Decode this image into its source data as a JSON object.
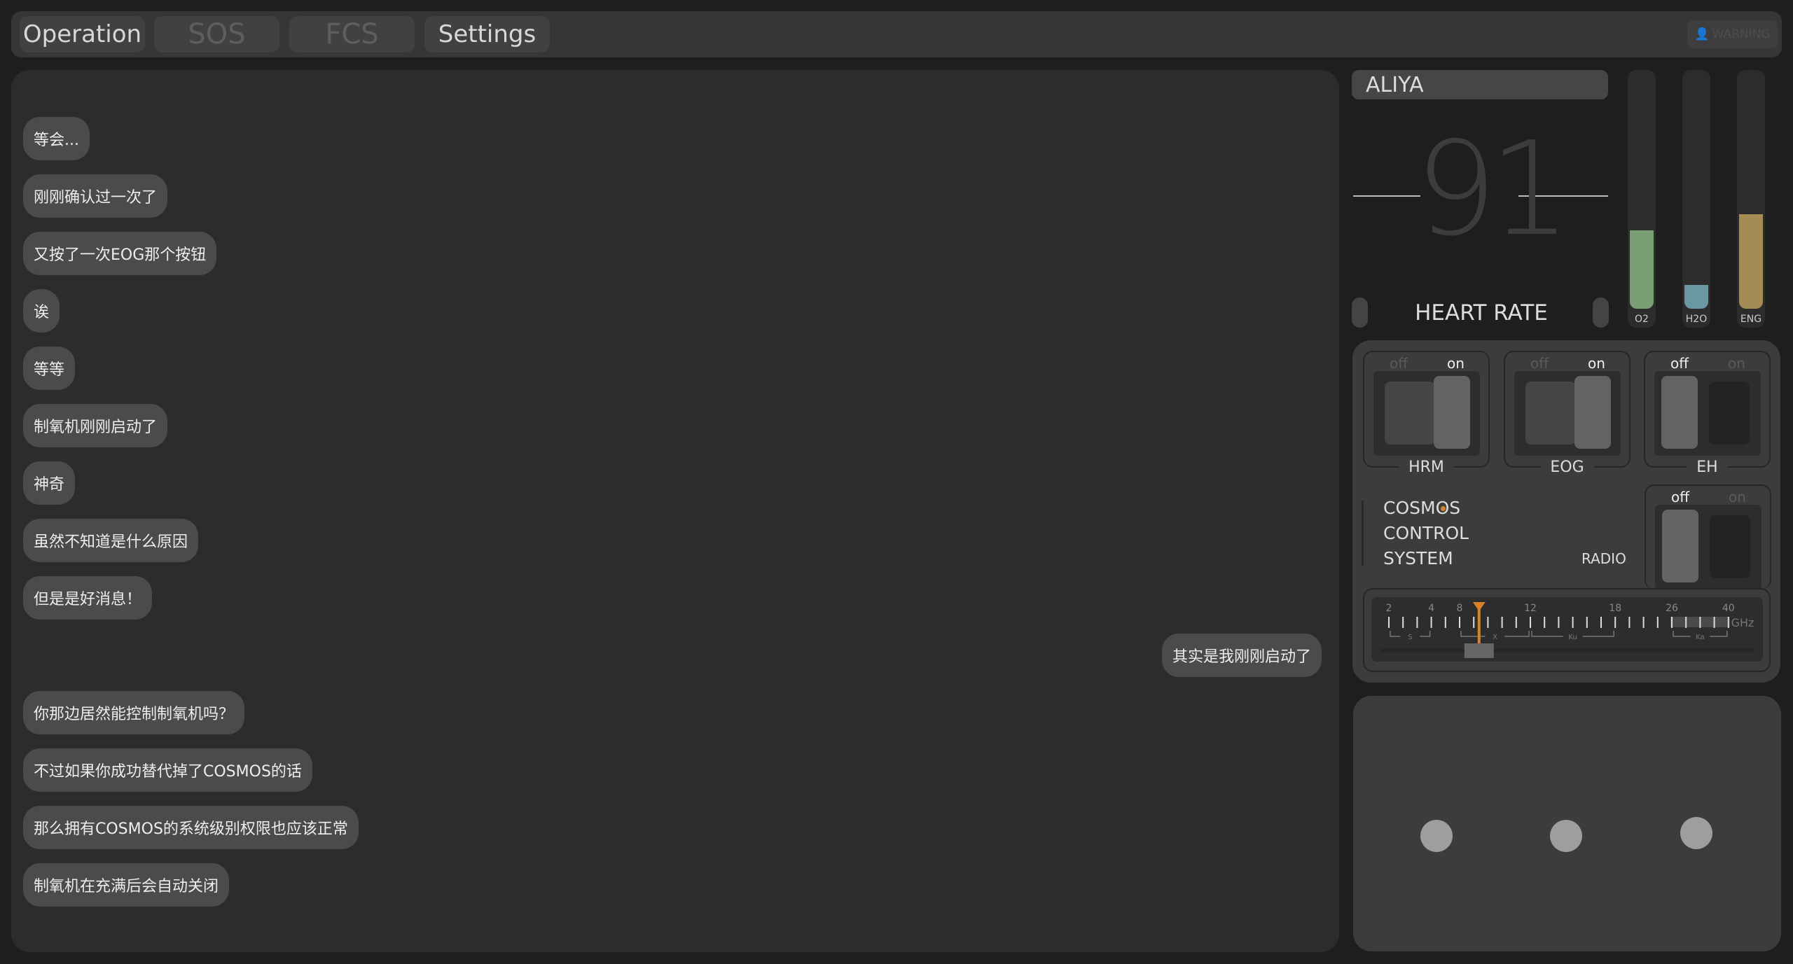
{
  "tabs": [
    {
      "label": "Operation",
      "enabled": true
    },
    {
      "label": "SOS",
      "enabled": false
    },
    {
      "label": "FCS",
      "enabled": false
    },
    {
      "label": "Settings",
      "enabled": true
    }
  ],
  "warning": {
    "label": "WARNING",
    "icon": "person-icon"
  },
  "chat": {
    "messages": [
      {
        "text": "等会...",
        "side": "left"
      },
      {
        "text": "刚刚确认过一次了",
        "side": "left"
      },
      {
        "text": "又按了一次EOG那个按钮",
        "side": "left"
      },
      {
        "text": "诶",
        "side": "left"
      },
      {
        "text": "等等",
        "side": "left"
      },
      {
        "text": "制氧机刚刚启动了",
        "side": "left"
      },
      {
        "text": "神奇",
        "side": "left"
      },
      {
        "text": "虽然不知道是什么原因",
        "side": "left"
      },
      {
        "text": "但是是好消息！",
        "side": "left"
      },
      {
        "text": "其实是我刚刚启动了",
        "side": "right"
      },
      {
        "text": "你那边居然能控制制氧机吗？",
        "side": "left"
      },
      {
        "text": "不过如果你成功替代掉了COSMOS的话",
        "side": "left"
      },
      {
        "text": "那么拥有COSMOS的系统级别权限也应该正常",
        "side": "left"
      },
      {
        "text": "制氧机在充满后会自动关闭",
        "side": "left"
      }
    ]
  },
  "status": {
    "name": "ALIYA",
    "heart_rate": "91",
    "heart_rate_label": "HEART RATE",
    "gauges": [
      {
        "label": "O2",
        "percent": 33,
        "color": "#7a9e74"
      },
      {
        "label": "H2O",
        "percent": 10,
        "color": "#6b97a3"
      },
      {
        "label": "ENG",
        "percent": 40,
        "color": "#a58c55"
      }
    ]
  },
  "switches": [
    {
      "name": "HRM",
      "state": "on"
    },
    {
      "name": "EOG",
      "state": "on"
    },
    {
      "name": "EH",
      "state": "off"
    }
  ],
  "switch_labels": {
    "off": "off",
    "on": "on"
  },
  "system": {
    "line1": "COSMOS",
    "line2": "CONTROL",
    "line3": "SYSTEM",
    "accent": "#d9822b"
  },
  "radio": {
    "label": "RADIO",
    "state": "off",
    "unit": "GHz",
    "tick_labels": [
      {
        "tick": 0,
        "text": "2"
      },
      {
        "tick": 3,
        "text": "4"
      },
      {
        "tick": 5,
        "text": "8"
      },
      {
        "tick": 10,
        "text": "12"
      },
      {
        "tick": 16,
        "text": "18"
      },
      {
        "tick": 20,
        "text": "26"
      },
      {
        "tick": 24,
        "text": "40"
      }
    ],
    "bands": [
      {
        "name": "S",
        "from": 0,
        "to": 3
      },
      {
        "name": "X",
        "from": 5,
        "to": 10
      },
      {
        "name": "Ku",
        "from": 10,
        "to": 16
      },
      {
        "name": "Ka",
        "from": 20,
        "to": 24
      }
    ],
    "tuner_ghz": 10,
    "pointer_color": "#d9822b"
  }
}
